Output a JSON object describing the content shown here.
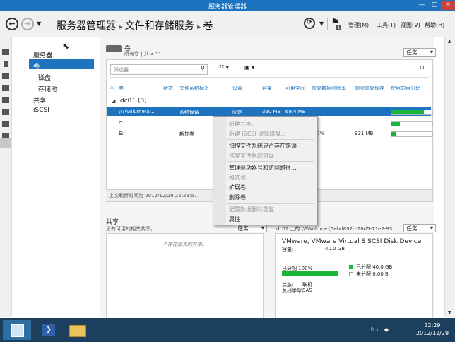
{
  "window": {
    "title": "服务器管理器",
    "min": "—",
    "max": "□",
    "close": "✕"
  },
  "nav": {
    "breadcrumb": [
      "服务器管理器",
      "文件和存储服务",
      "卷"
    ],
    "menus": [
      "管理(M)",
      "工具(T)",
      "视图(V)",
      "帮助(H)"
    ],
    "flag_count": "1"
  },
  "sidebar": {
    "items": [
      {
        "label": "服务器"
      },
      {
        "label": "卷"
      },
      {
        "label": "磁盘"
      },
      {
        "label": "存储池"
      },
      {
        "label": "共享"
      },
      {
        "label": "iSCSI"
      }
    ]
  },
  "volumes": {
    "title": "卷",
    "subtitle": "所有卷 | 共 3 个",
    "tasks_label": "任务",
    "filter_placeholder": "筛选器",
    "columns": [
      "卷",
      "状态",
      "文件系统标签",
      "设置",
      "容量",
      "可用空间",
      "重复数据删除率",
      "删除重复保存",
      "使用的百分比"
    ],
    "group": "dc01 (3)",
    "rows": [
      {
        "volume": "\\\\?\\Volume(5...",
        "label": "系统保留",
        "setting": "固定",
        "capacity": "350 MB",
        "free": "69.4 MB",
        "dedup_rate": "",
        "saved": "",
        "used_pct": 0.8
      },
      {
        "volume": "C:",
        "label": "",
        "setting": "",
        "capacity": "",
        "free": "",
        "dedup_rate": "",
        "saved": "",
        "used_pct": 0.2
      },
      {
        "volume": "E:",
        "label": "新加卷",
        "setting": "",
        "capacity": "",
        "free": "",
        "dedup_rate": "0%",
        "saved": "931 MB",
        "used_pct": 0.1
      }
    ],
    "footer": "上次刷新时间为 2012/12/29 22:28:57"
  },
  "context_menu": {
    "items": [
      {
        "label": "新建共享...",
        "enabled": false
      },
      {
        "label": "新建 iSCSI 虚拟磁盘...",
        "enabled": false
      },
      {
        "label": "扫描文件系统是否存在错误",
        "enabled": true
      },
      {
        "label": "修复文件系统错误",
        "enabled": false
      },
      {
        "label": "管理驱动器号和访问路径...",
        "enabled": true
      },
      {
        "label": "格式化...",
        "enabled": false
      },
      {
        "label": "扩展卷...",
        "enabled": true
      },
      {
        "label": "删除卷",
        "enabled": true
      },
      {
        "label": "配置数据删除重复",
        "enabled": false
      },
      {
        "label": "属性",
        "enabled": true
      }
    ]
  },
  "shares": {
    "title": "共享",
    "subtitle": "没有可用的相关共享。",
    "tasks_label": "任务",
    "empty": "不存在相关的共享。"
  },
  "disk": {
    "header": "dc01 上的 \\\\?\\Volume{5ebd892b-28d5-11e2-93...",
    "tasks_label": "任务",
    "name": "VMware, VMware Virtual S SCSI Disk Device",
    "capacity_label": "容量:",
    "capacity": "40.0 GB",
    "allocated_text": "已分配 100%",
    "allocated_fraction": 1.0,
    "legend_allocated": "已分配 40.0 GB",
    "legend_unallocated": "未分配 0.00 B",
    "status_label": "状态:",
    "status": "联机",
    "bus_label": "总线类型:",
    "bus": "SAS"
  },
  "taskbar": {
    "time": "22:29",
    "date": "2012/12/29"
  },
  "colors": {
    "accent": "#1e73be",
    "bar_green": "#18b53b",
    "taskbar": "#1b3f5c"
  }
}
